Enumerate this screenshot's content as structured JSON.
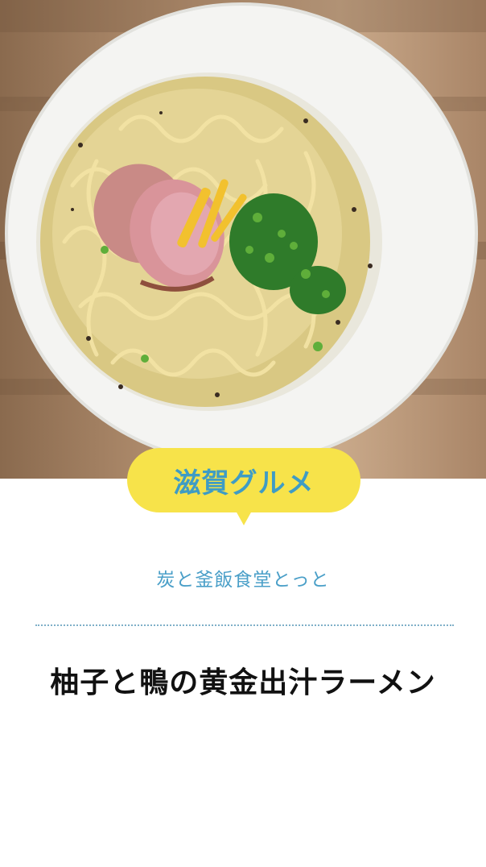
{
  "hero": {
    "image_alt": "ramen-bowl-photo"
  },
  "badge": {
    "label": "滋賀グルメ"
  },
  "restaurant": {
    "name": "炭と釜飯食堂とっと"
  },
  "dish": {
    "title": "柚子と鴨の黄金出汁ラーメン"
  },
  "colors": {
    "badge_bg": "#f7e34a",
    "badge_text": "#3f9cc4",
    "restaurant_text": "#4a9fc8",
    "divider": "#7fb0c8",
    "title_text": "#111111"
  }
}
